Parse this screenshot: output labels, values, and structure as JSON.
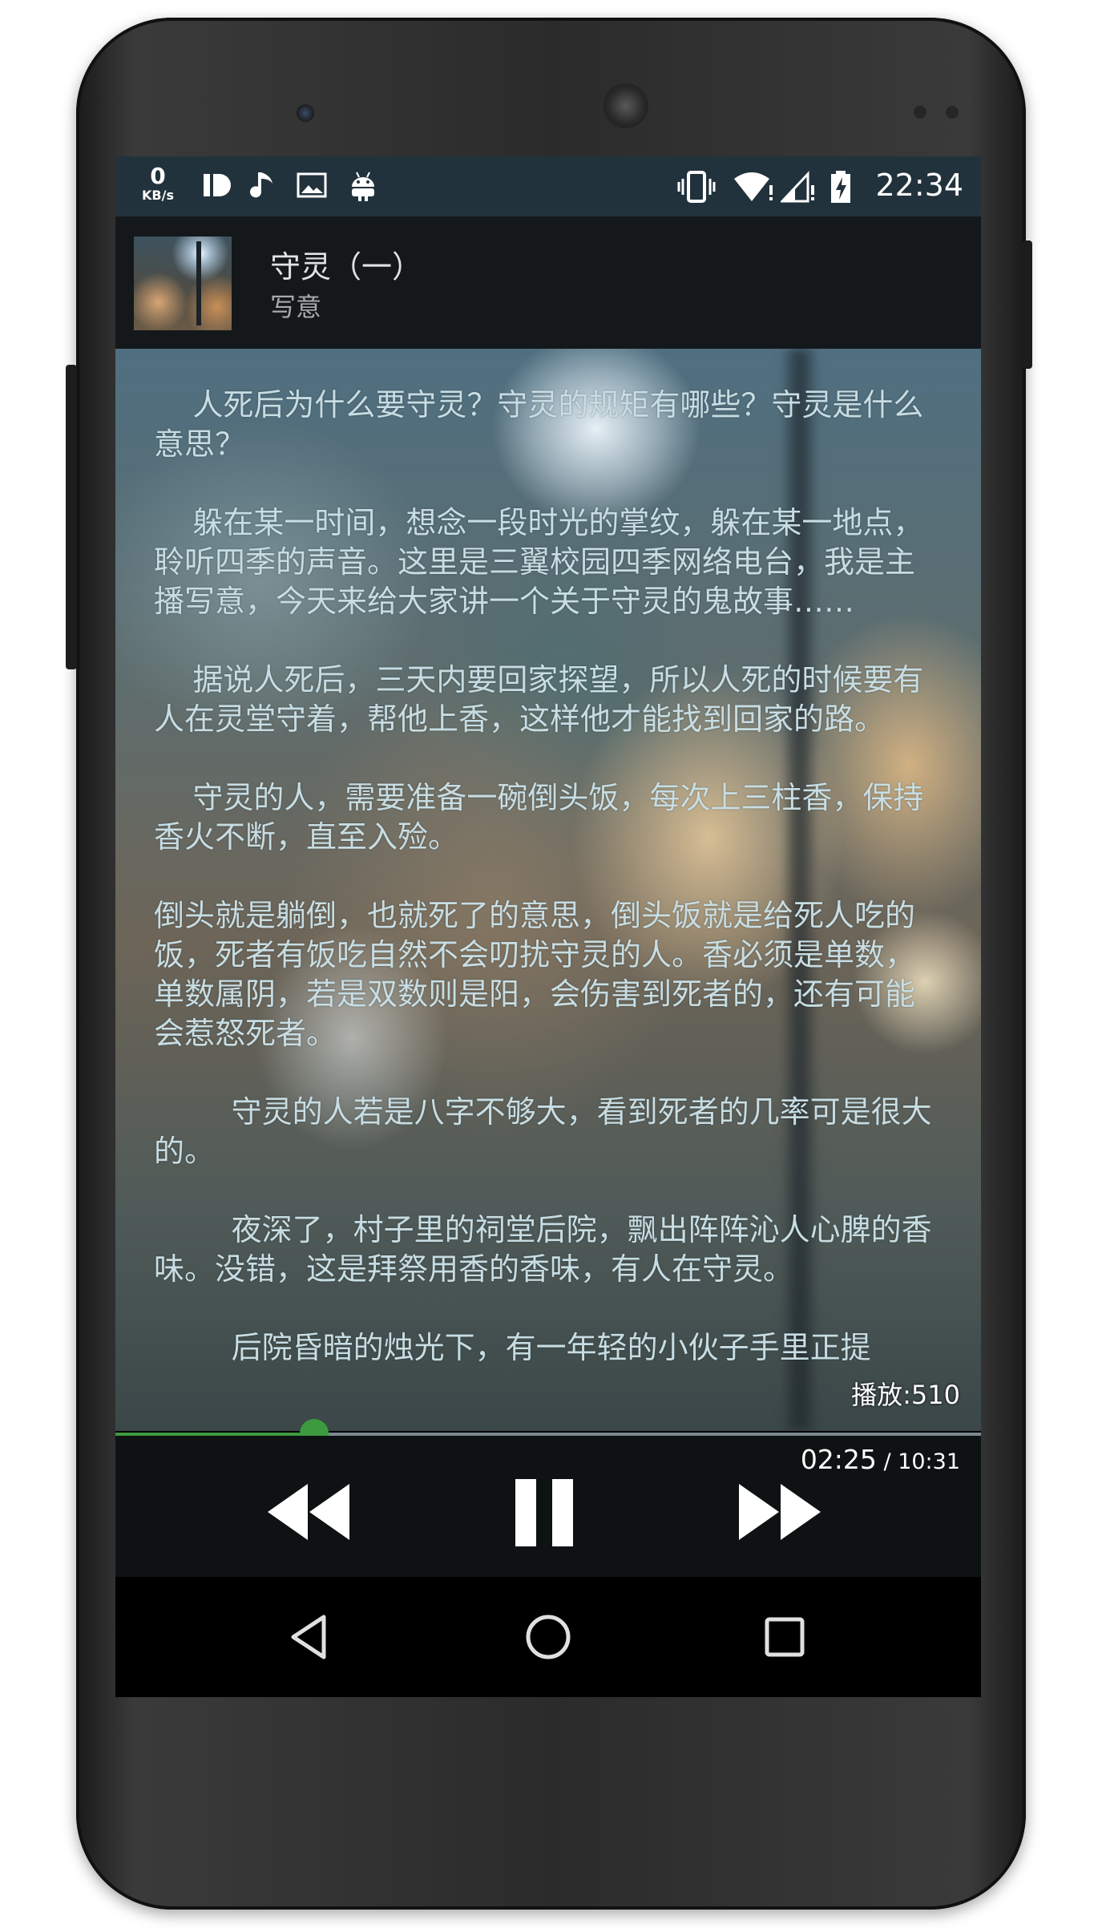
{
  "status_bar": {
    "net_speed_value": "0",
    "net_speed_unit": "KB/s",
    "time": "22:34",
    "left_icons": [
      "id-icon",
      "music-note-icon",
      "image-icon",
      "android-icon"
    ],
    "right_icons": [
      "vibrate-icon",
      "wifi-icon",
      "signal-icon",
      "battery-charging-icon"
    ]
  },
  "track": {
    "title": "守灵（一）",
    "author": "写意"
  },
  "article": {
    "paragraphs": [
      "    人死后为什么要守灵？守灵的规矩有哪些？守灵是什么意思？",
      "    躲在某一时间，想念一段时光的掌纹，躲在某一地点，聆听四季的声音。这里是三翼校园四季网络电台，我是主播写意，今天来给大家讲一个关于守灵的鬼故事……",
      "    据说人死后，三天内要回家探望，所以人死的时候要有人在灵堂守着，帮他上香，这样他才能找到回家的路。",
      "    守灵的人，需要准备一碗倒头饭，每次上三柱香，保持香火不断，直至入殓。",
      "倒头就是躺倒，也就死了的意思，倒头饭就是给死人吃的饭，死者有饭吃自然不会叨扰守灵的人。香必须是单数，单数属阴，若是双数则是阳，会伤害到死者的，还有可能会惹怒死者。",
      "        守灵的人若是八字不够大，看到死者的几率可是很大的。",
      "        夜深了，村子里的祠堂后院，飘出阵阵沁人心脾的香味。没错，这是拜祭用香的香味，有人在守灵。",
      "        后院昏暗的烛光下，有一年轻的小伙子手里正提"
    ]
  },
  "player": {
    "play_count": "播放:510",
    "current_time": "02:25",
    "separator": " / ",
    "total_time": "10:31",
    "progress_fraction": 0.23,
    "accent_color": "#3d9a3f",
    "buttons": [
      "rewind-icon",
      "pause-icon",
      "fast-forward-icon"
    ]
  },
  "nav": {
    "buttons": [
      "back-icon",
      "home-icon",
      "recents-icon"
    ]
  }
}
